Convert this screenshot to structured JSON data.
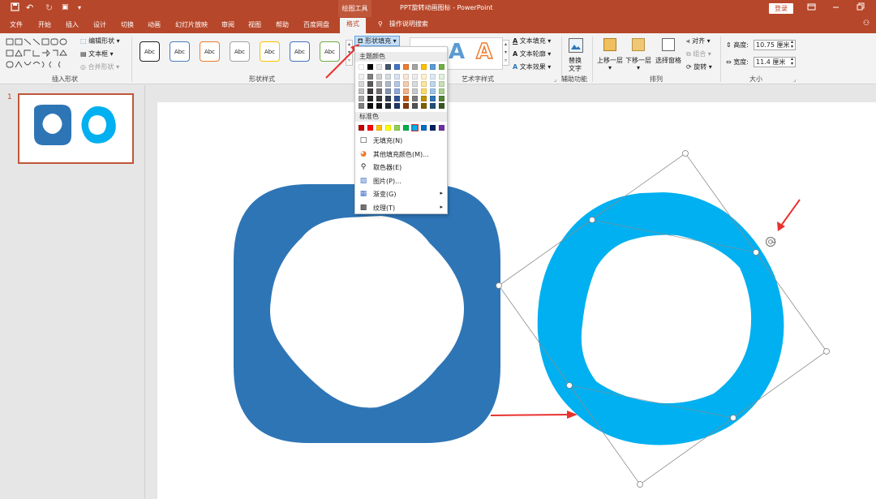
{
  "titlebar": {
    "context_tools": "绘图工具",
    "doc_title": "PPT旋转动画图标 - PowerPoint",
    "login": "登录"
  },
  "tabs": [
    "文件",
    "开始",
    "插入",
    "设计",
    "切换",
    "动画",
    "幻灯片放映",
    "审阅",
    "视图",
    "帮助",
    "百度网盘"
  ],
  "active_tab": "格式",
  "tell_me": "操作说明搜索",
  "ribbon": {
    "insert_shapes": {
      "label": "插入形状",
      "edit_shape": "编辑形状",
      "text_box": "文本框",
      "merge_shapes": "合并形状"
    },
    "shape_styles": {
      "label": "形状样式",
      "abc": "Abc",
      "fill": "形状填充",
      "style_colors": [
        "#222222",
        "#4a7ebb",
        "#ed7d31",
        "#a5a5a5",
        "#ffc000",
        "#4472c4",
        "#70ad47"
      ]
    },
    "wordart": {
      "label": "艺术字样式",
      "text_fill": "文本填充",
      "text_outline": "文本轮廓",
      "text_effects": "文本效果"
    },
    "accessibility": {
      "label": "辅助功能",
      "alt_text_l1": "替换",
      "alt_text_l2": "文字"
    },
    "arrange": {
      "label": "排列",
      "bring_forward": "上移一层",
      "send_backward": "下移一层",
      "selection_pane": "选择窗格",
      "align": "对齐",
      "group": "组合",
      "rotate": "旋转"
    },
    "size": {
      "label": "大小",
      "height_label": "高度:",
      "height_value": "10.75 厘米",
      "width_label": "宽度:",
      "width_value": "11.4 厘米"
    }
  },
  "dropdown": {
    "theme_colors_header": "主题颜色",
    "standard_colors_header": "标准色",
    "theme_top_row": [
      "#ffffff",
      "#000000",
      "#e7e6e6",
      "#44546a",
      "#4472c4",
      "#ed7d31",
      "#a5a5a5",
      "#ffc000",
      "#5b9bd5",
      "#70ad47"
    ],
    "theme_shades": [
      [
        "#f2f2f2",
        "#7f7f7f",
        "#d0cece",
        "#d6dce4",
        "#d9e2f3",
        "#fbe5d5",
        "#ededed",
        "#fff2cc",
        "#deebf6",
        "#e2efd9"
      ],
      [
        "#d8d8d8",
        "#595959",
        "#aeabab",
        "#adb9ca",
        "#b4c6e7",
        "#f7cbac",
        "#dbdbdb",
        "#fee599",
        "#bdd7ee",
        "#c5e0b3"
      ],
      [
        "#bfbfbf",
        "#3f3f3f",
        "#757070",
        "#8496b0",
        "#8eaadb",
        "#f4b183",
        "#c9c9c9",
        "#ffd965",
        "#9cc3e5",
        "#a8d08d"
      ],
      [
        "#a5a5a5",
        "#262626",
        "#3a3838",
        "#323f4f",
        "#2f5496",
        "#c55a11",
        "#7b7b7b",
        "#bf9000",
        "#2e75b5",
        "#538135"
      ],
      [
        "#7f7f7f",
        "#0c0c0c",
        "#171616",
        "#222a35",
        "#1f3864",
        "#833c0b",
        "#525252",
        "#7f6000",
        "#1f4e79",
        "#375623"
      ]
    ],
    "standard_colors": [
      "#c00000",
      "#ff0000",
      "#ffc000",
      "#ffff00",
      "#92d050",
      "#00b050",
      "#00b0f0",
      "#0070c0",
      "#002060",
      "#7030a0"
    ],
    "items": [
      {
        "icon": "no-fill-icon",
        "label": "无填充(N)",
        "arrow": ""
      },
      {
        "icon": "palette-icon",
        "label": "其他填充颜色(M)...",
        "arrow": ""
      },
      {
        "icon": "eyedropper-icon",
        "label": "取色器(E)",
        "arrow": ""
      },
      {
        "icon": "picture-icon",
        "label": "图片(P)...",
        "arrow": ""
      },
      {
        "icon": "gradient-icon",
        "label": "渐变(G)",
        "arrow": "▸"
      },
      {
        "icon": "texture-icon",
        "label": "纹理(T)",
        "arrow": "▸"
      }
    ]
  },
  "slides": {
    "number": "1"
  },
  "colors": {
    "accent": "#b7472a",
    "shape_dark_blue": "#2e75b6",
    "shape_light_blue": "#00b0f0",
    "arrow_red": "#e8322f"
  }
}
